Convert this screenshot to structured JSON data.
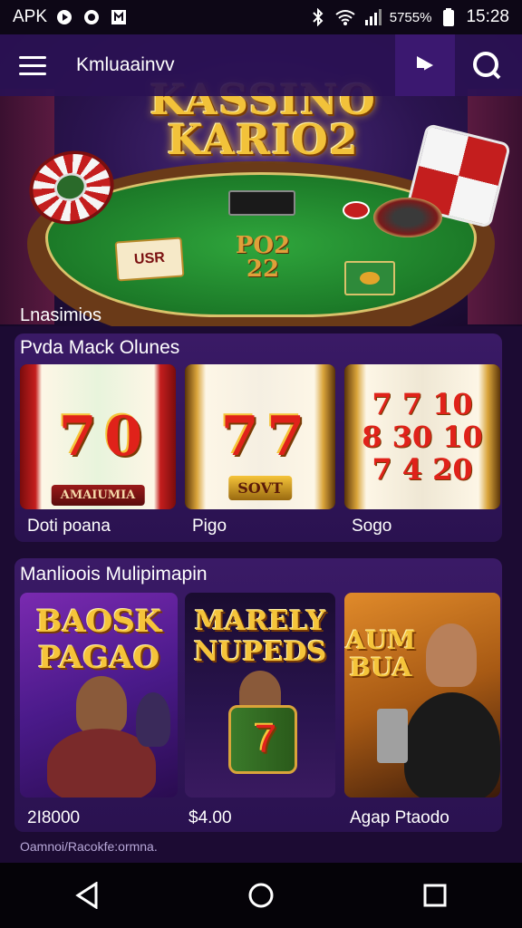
{
  "status_bar": {
    "carrier_label": "APK",
    "battery_pct": "5755%",
    "time": "15:28"
  },
  "app_bar": {
    "title": "Kmluaainvv",
    "icons": [
      "menu-icon",
      "play-icon",
      "search-icon"
    ]
  },
  "hero": {
    "logo_line1": "KASSINO",
    "logo_line2": "KARIO2",
    "table_number_line1": "PO2",
    "table_number_line2": "22",
    "card_text": "USR"
  },
  "sections": {
    "subtitle": "Lnasimios",
    "popular": {
      "title": "Pvda Mack Olunes",
      "tiles": [
        {
          "label": "Doti poana",
          "plate": "AMAIUMIA",
          "art": "7 0"
        },
        {
          "label": "Pigo",
          "plate": "SOVT",
          "art": "7 7"
        },
        {
          "label": "Sogo",
          "art_line1": "7 7 10",
          "art_line2": "8 30 10",
          "art_line3": "7 4 20"
        }
      ]
    },
    "multiplayer": {
      "title": "Manlioois Mulipimapin",
      "tiles": [
        {
          "label": "2I8000",
          "promo_line1": "BAOSK",
          "promo_line2": "PAGAO"
        },
        {
          "label": "$4.00",
          "promo_line1": "MARELY",
          "promo_line2": "NUPEDS",
          "art": "7"
        },
        {
          "label": "Agap Ptaodo",
          "promo_line1": "AUM",
          "promo_line2": "BUA"
        }
      ]
    }
  },
  "footnote": "Oamnoi/Racokfe:ormna.",
  "nav_bar": {
    "icons": [
      "back-icon",
      "home-icon",
      "recents-icon"
    ]
  }
}
